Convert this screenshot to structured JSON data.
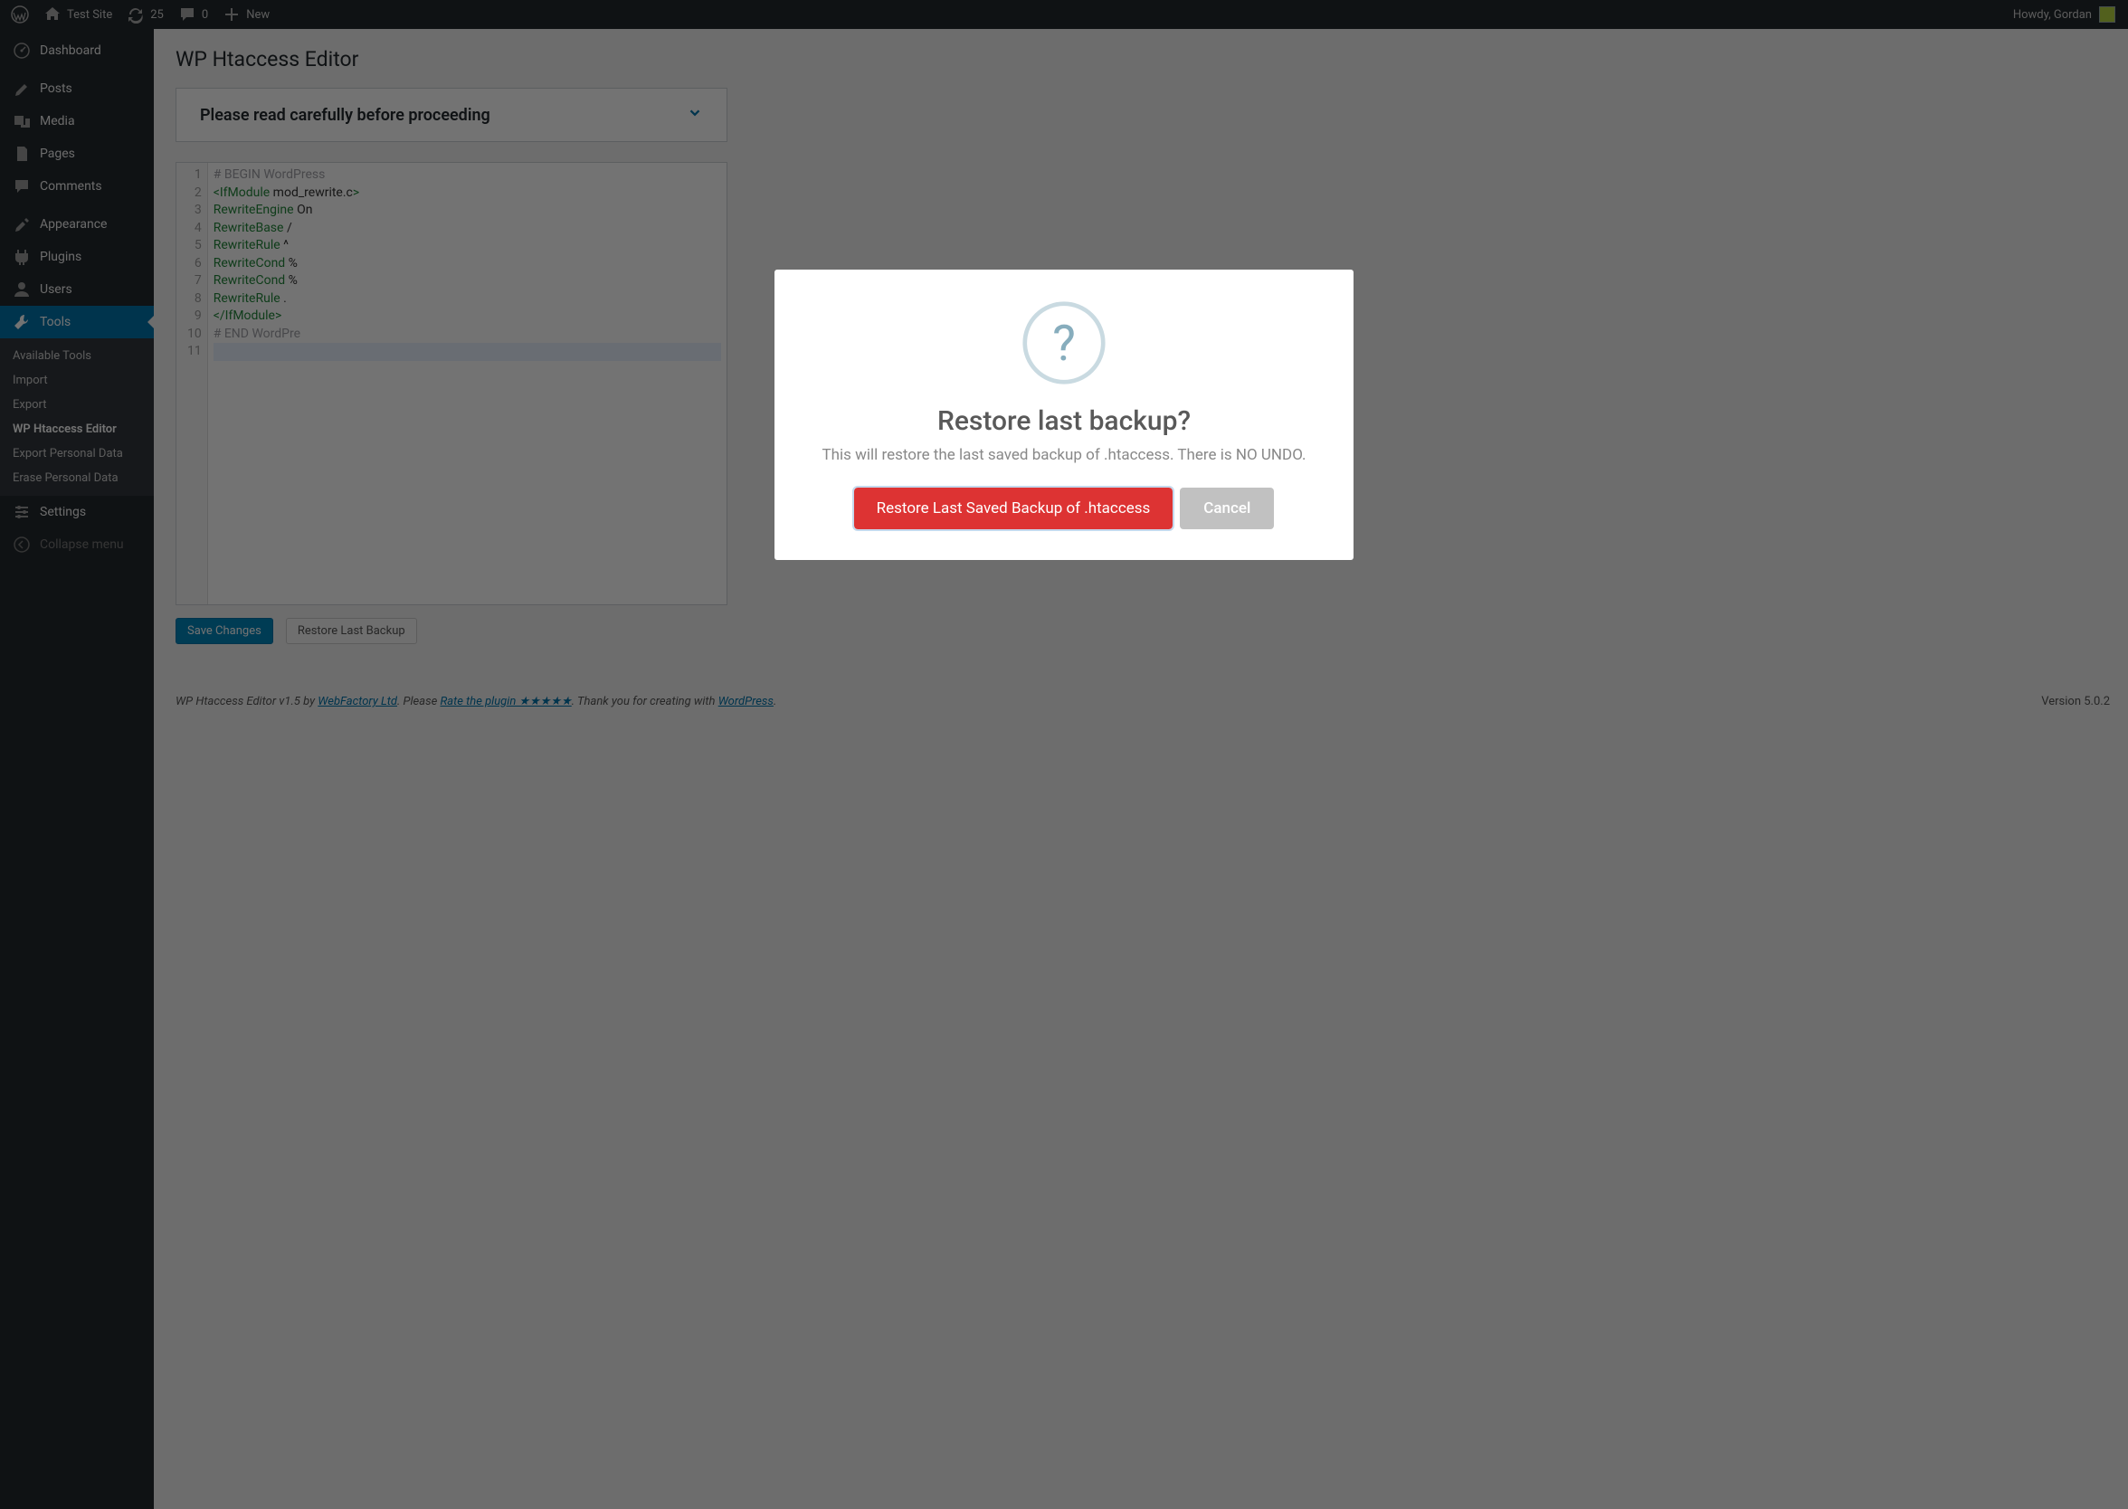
{
  "admin_bar": {
    "site_name": "Test Site",
    "updates": "25",
    "comments": "0",
    "new": "New",
    "greeting": "Howdy, Gordan"
  },
  "sidebar": {
    "dashboard": "Dashboard",
    "posts": "Posts",
    "media": "Media",
    "pages": "Pages",
    "comments": "Comments",
    "appearance": "Appearance",
    "plugins": "Plugins",
    "users": "Users",
    "tools": "Tools",
    "settings": "Settings",
    "collapse": "Collapse menu",
    "submenu": {
      "available": "Available Tools",
      "import": "Import",
      "export": "Export",
      "htaccess": "WP Htaccess Editor",
      "export_personal": "Export Personal Data",
      "erase_personal": "Erase Personal Data"
    }
  },
  "page": {
    "title": "WP Htaccess Editor",
    "accordion": "Please read carefully before proceeding",
    "save": "Save Changes",
    "restore": "Restore Last Backup",
    "code": [
      "# BEGIN WordPress",
      "<IfModule mod_rewrite.c>",
      "RewriteEngine On",
      "RewriteBase /",
      "RewriteRule ^",
      "RewriteCond %",
      "RewriteCond %",
      "RewriteRule .",
      "</IfModule>",
      "# END WordPre",
      ""
    ]
  },
  "footer": {
    "prefix": "WP Htaccess Editor v1.5 by ",
    "vendor": "WebFactory Ltd",
    "mid1": ". Please ",
    "rate": "Rate the plugin ★★★★★",
    "mid2": ". Thank you for creating with ",
    "wp": "WordPress",
    "tail": ".",
    "version": "Version 5.0.2"
  },
  "modal": {
    "title": "Restore last backup?",
    "text": "This will restore the last saved backup of .htaccess. There is NO UNDO.",
    "confirm": "Restore Last Saved Backup of .htaccess",
    "cancel": "Cancel"
  }
}
